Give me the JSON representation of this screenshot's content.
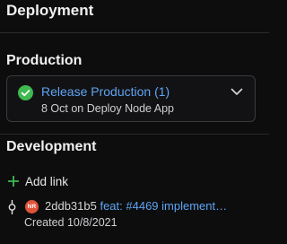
{
  "deployment": {
    "title": "Deployment"
  },
  "production": {
    "title": "Production",
    "release": {
      "title": "Release Production (1)",
      "subtitle": "8 Oct on Deploy Node App",
      "status": "success",
      "status_color": "#3fb950",
      "status_icon": "check-circle-icon",
      "expand_icon": "chevron-down-icon"
    }
  },
  "development": {
    "title": "Development",
    "add_link_label": "Add link",
    "add_link_icon": "plus-icon",
    "add_link_color": "#3fb950",
    "commit": {
      "icon": "git-commit-icon",
      "avatar_initials": "NR",
      "avatar_color": "#e0533a",
      "hash": "2ddb31b5",
      "message": "feat: #4469 implement…",
      "created": "Created 10/8/2021"
    }
  },
  "colors": {
    "background": "#0d0d0e",
    "link": "#5fa4f3",
    "text": "#e6e6e6",
    "muted": "#cfcfd2"
  }
}
